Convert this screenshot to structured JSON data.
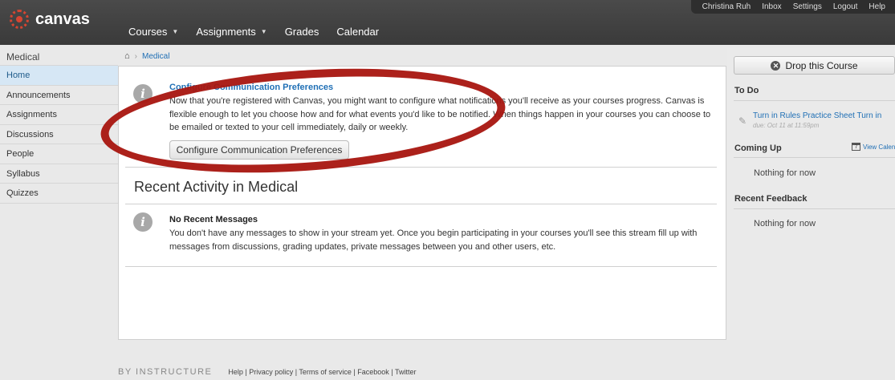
{
  "user_bar": {
    "name": "Christina Ruh",
    "inbox": "Inbox",
    "settings": "Settings",
    "logout": "Logout",
    "help": "Help"
  },
  "header": {
    "logo_text": "canvas",
    "nav": {
      "courses": "Courses",
      "assignments": "Assignments",
      "grades": "Grades",
      "calendar": "Calendar"
    }
  },
  "sidebar": {
    "course_title": "Medical",
    "items": [
      {
        "label": "Home"
      },
      {
        "label": "Announcements"
      },
      {
        "label": "Assignments"
      },
      {
        "label": "Discussions"
      },
      {
        "label": "People"
      },
      {
        "label": "Syllabus"
      },
      {
        "label": "Quizzes"
      }
    ]
  },
  "breadcrumb": {
    "current": "Medical"
  },
  "main": {
    "pref_title": "Configure Communication Preferences",
    "pref_body": "Now that you're registered with Canvas, you might want to configure what notifications you'll receive as your courses progress. Canvas is flexible enough to let you choose how and for what events you'd like to be notified. When things happen in your courses you can choose to be emailed or texted to your cell immediately, daily or weekly.",
    "pref_button": "Configure Communication Preferences",
    "recent_heading": "Recent Activity in Medical",
    "stream_title": "No Recent Messages",
    "stream_body": "You don't have any messages to show in your stream yet. Once you begin participating in your courses you'll see this stream fill up with messages from discussions, grading updates, private messages between you and other users, etc."
  },
  "right_sidebar": {
    "drop_button": "Drop this Course",
    "todo_heading": "To Do",
    "todo_item": "Turn in Rules Practice Sheet Turn in",
    "todo_due": "due: Oct 11 at 11:59pm",
    "coming_up_heading": "Coming Up",
    "view_calendar": "View Calendar",
    "coming_up_empty": "Nothing for now",
    "feedback_heading": "Recent Feedback",
    "feedback_empty": "Nothing for now"
  },
  "footer": {
    "brand": "BY INSTRUCTURE",
    "links": "Help | Privacy policy | Terms of service | Facebook | Twitter"
  },
  "colors": {
    "header_bg": "#3f3f3f",
    "link_blue": "#1f6fb5",
    "active_nav_bg": "#d6e7f5",
    "annotation_red": "#a8150f",
    "logo_red": "#d64531"
  }
}
